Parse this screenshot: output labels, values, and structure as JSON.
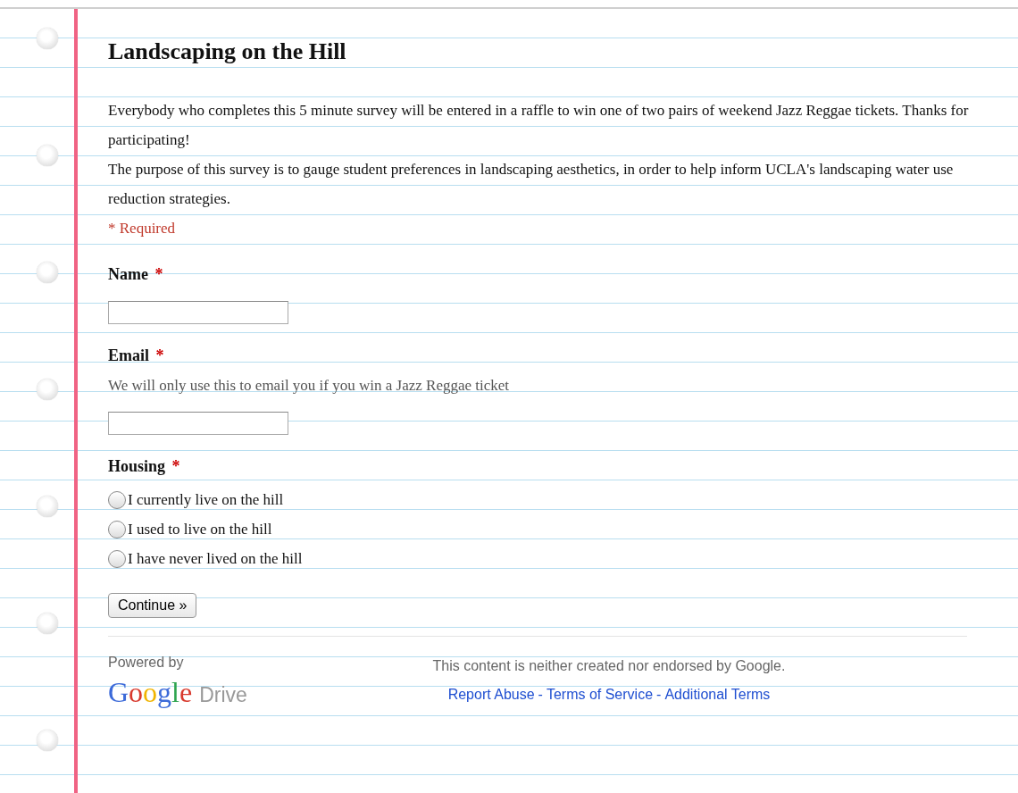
{
  "form": {
    "title": "Landscaping on the Hill",
    "description": [
      "Everybody who completes this 5 minute survey will be entered in a raffle to win one of two pairs of weekend Jazz Reggae tickets. Thanks for participating!",
      "The purpose of this survey is to gauge student preferences in landscaping aesthetics, in order to help inform UCLA's landscaping water use reduction strategies."
    ],
    "required_note": "* Required",
    "questions": [
      {
        "kind": "text",
        "title": "Name",
        "required_mark": "*"
      },
      {
        "kind": "text",
        "title": "Email",
        "required_mark": "*",
        "help": "We will only use this to email you if you win a Jazz Reggae ticket"
      },
      {
        "kind": "radio",
        "title": "Housing",
        "required_mark": "*",
        "options": [
          {
            "label": "I currently live on the hill",
            "selected": false
          },
          {
            "label": "I used to live on the hill",
            "selected": false
          },
          {
            "label": "I have never lived on the hill",
            "selected": false
          }
        ]
      }
    ],
    "submit_button": "Continue »"
  },
  "footer": {
    "powered_by": "Powered by",
    "logo": "Google",
    "product": "Drive",
    "disclaimer": "This content is neither created nor endorsed by Google.",
    "links": [
      "Report Abuse",
      "Terms of Service",
      "Additional Terms"
    ],
    "separator": "-"
  }
}
